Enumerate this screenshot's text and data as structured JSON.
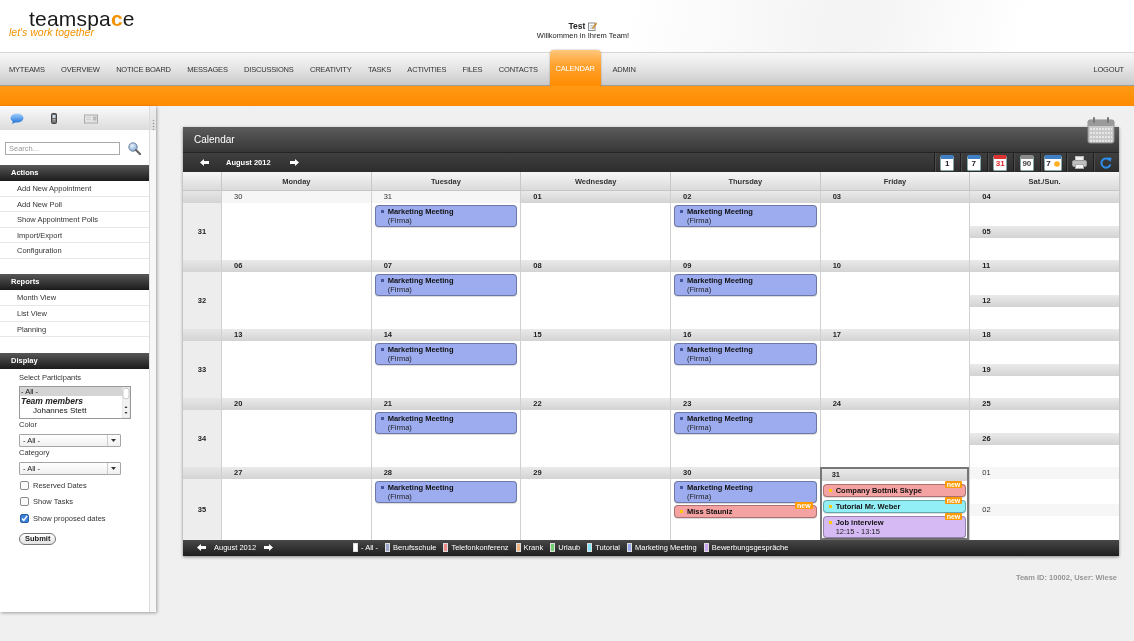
{
  "header": {
    "logo": {
      "wordmark": "teamspace",
      "tagline": "let's work together"
    },
    "user": {
      "name": "Test",
      "greeting": "Willkommen in Ihrem Team!"
    }
  },
  "nav": {
    "tabs": [
      {
        "label": "MYTEAMS",
        "selected": false
      },
      {
        "label": "OVERVIEW",
        "selected": false
      },
      {
        "label": "NOTICE BOARD",
        "selected": false
      },
      {
        "label": "MESSAGES",
        "selected": false
      },
      {
        "label": "DISCUSSIONS",
        "selected": false
      },
      {
        "label": "CREATIVITY",
        "selected": false
      },
      {
        "label": "TASKS",
        "selected": false
      },
      {
        "label": "ACTIVITIES",
        "selected": false
      },
      {
        "label": "FILES",
        "selected": false
      },
      {
        "label": "CONTACTS",
        "selected": false
      },
      {
        "label": "CALENDAR",
        "selected": true
      },
      {
        "label": "ADMIN",
        "selected": false
      }
    ],
    "logout": "LOGOUT"
  },
  "sidebar": {
    "search": {
      "placeholder": "Search..."
    },
    "sections": [
      {
        "title": "Actions",
        "items": [
          "Add New Appointment",
          "Add New Poll",
          "Show Appointment Polls",
          "Import/Export",
          "Configuration"
        ]
      },
      {
        "title": "Reports",
        "items": [
          "Month View",
          "List View",
          "Planning"
        ]
      }
    ],
    "display": {
      "title": "Display",
      "participants": {
        "label": "Select Participants",
        "options": [
          {
            "kind": "option",
            "label": "- All -",
            "selected": true
          },
          {
            "kind": "group",
            "label": "Team members",
            "children": [
              {
                "label": "Johannes Stett",
                "selected": false
              }
            ]
          }
        ]
      },
      "filters": [
        {
          "label": "Color",
          "value": "- All -"
        },
        {
          "label": "Category",
          "value": "- All -"
        }
      ],
      "checkboxes": [
        {
          "label": "Reserved Dates",
          "checked": false
        },
        {
          "label": "Show Tasks",
          "checked": false
        },
        {
          "label": "Show proposed dates",
          "checked": true
        }
      ],
      "submit": "Submit"
    }
  },
  "calendar": {
    "title": "Calendar",
    "month": "August 2012",
    "views": [
      {
        "kind": "day",
        "label": "1"
      },
      {
        "kind": "week",
        "label": "7"
      },
      {
        "kind": "month",
        "label": "31"
      },
      {
        "kind": "quarter",
        "label": "90"
      },
      {
        "kind": "year",
        "label": "7"
      },
      {
        "kind": "print"
      },
      {
        "kind": "refresh"
      }
    ],
    "weekday_headers": [
      "Monday",
      "Tuesday",
      "Wednesday",
      "Thursday",
      "Friday",
      "Sat./Sun."
    ],
    "weeks": [
      {
        "number": "31",
        "days": [
          {
            "date": "30",
            "other_month": true,
            "today": false
          },
          {
            "date": "31",
            "other_month": true,
            "today": false,
            "events": [
              {
                "title": "Marketing Meeting",
                "detail": "(Firma)",
                "color": "#9cacef",
                "new": false
              }
            ]
          },
          {
            "date": "01",
            "other_month": false,
            "today": false
          },
          {
            "date": "02",
            "other_month": false,
            "today": false,
            "events": [
              {
                "title": "Marketing Meeting",
                "detail": "(Firma)",
                "color": "#9cacef",
                "new": false
              }
            ]
          },
          {
            "date": "03",
            "other_month": false,
            "today": false
          }
        ],
        "weekend": [
          {
            "date": "04",
            "other_month": false
          },
          {
            "date": "05",
            "other_month": false
          }
        ]
      },
      {
        "number": "32",
        "days": [
          {
            "date": "06",
            "other_month": false,
            "today": false
          },
          {
            "date": "07",
            "other_month": false,
            "today": false,
            "events": [
              {
                "title": "Marketing Meeting",
                "detail": "(Firma)",
                "color": "#9cacef",
                "new": false
              }
            ]
          },
          {
            "date": "08",
            "other_month": false,
            "today": false
          },
          {
            "date": "09",
            "other_month": false,
            "today": false,
            "events": [
              {
                "title": "Marketing Meeting",
                "detail": "(Firma)",
                "color": "#9cacef",
                "new": false
              }
            ]
          },
          {
            "date": "10",
            "other_month": false,
            "today": false
          }
        ],
        "weekend": [
          {
            "date": "11",
            "other_month": false
          },
          {
            "date": "12",
            "other_month": false
          }
        ]
      },
      {
        "number": "33",
        "days": [
          {
            "date": "13",
            "other_month": false,
            "today": false
          },
          {
            "date": "14",
            "other_month": false,
            "today": false,
            "events": [
              {
                "title": "Marketing Meeting",
                "detail": "(Firma)",
                "color": "#9cacef",
                "new": false
              }
            ]
          },
          {
            "date": "15",
            "other_month": false,
            "today": false
          },
          {
            "date": "16",
            "other_month": false,
            "today": false,
            "events": [
              {
                "title": "Marketing Meeting",
                "detail": "(Firma)",
                "color": "#9cacef",
                "new": false
              }
            ]
          },
          {
            "date": "17",
            "other_month": false,
            "today": false
          }
        ],
        "weekend": [
          {
            "date": "18",
            "other_month": false
          },
          {
            "date": "19",
            "other_month": false
          }
        ]
      },
      {
        "number": "34",
        "days": [
          {
            "date": "20",
            "other_month": false,
            "today": false
          },
          {
            "date": "21",
            "other_month": false,
            "today": false,
            "events": [
              {
                "title": "Marketing Meeting",
                "detail": "(Firma)",
                "color": "#9cacef",
                "new": false
              }
            ]
          },
          {
            "date": "22",
            "other_month": false,
            "today": false
          },
          {
            "date": "23",
            "other_month": false,
            "today": false,
            "events": [
              {
                "title": "Marketing Meeting",
                "detail": "(Firma)",
                "color": "#9cacef",
                "new": false
              }
            ]
          },
          {
            "date": "24",
            "other_month": false,
            "today": false
          }
        ],
        "weekend": [
          {
            "date": "25",
            "other_month": false
          },
          {
            "date": "26",
            "other_month": false
          }
        ]
      },
      {
        "number": "35",
        "days": [
          {
            "date": "27",
            "other_month": false,
            "today": false
          },
          {
            "date": "28",
            "other_month": false,
            "today": false,
            "events": [
              {
                "title": "Marketing Meeting",
                "detail": "(Firma)",
                "color": "#9cacef",
                "new": false
              }
            ]
          },
          {
            "date": "29",
            "other_month": false,
            "today": false
          },
          {
            "date": "30",
            "other_month": false,
            "today": false,
            "events": [
              {
                "title": "Marketing Meeting",
                "detail": "(Firma)",
                "color": "#9cacef",
                "new": false
              },
              {
                "title": "Miss Stauniz",
                "color": "#f5a2a2",
                "new": true,
                "badge": "new"
              }
            ]
          },
          {
            "date": "31",
            "other_month": false,
            "today": true,
            "events": [
              {
                "title": "Company Bottnik Skype",
                "color": "#f5a2a2",
                "new": true,
                "badge": "new"
              },
              {
                "title": "Tutorial Mr. Weber",
                "color": "#92eff6",
                "new": true,
                "badge": "new"
              },
              {
                "title": "Job interview",
                "detail": "12:15 - 13:15",
                "color": "#d6baf4",
                "new": true,
                "badge": "new"
              }
            ]
          }
        ],
        "weekend": [
          {
            "date": "01",
            "other_month": true
          },
          {
            "date": "02",
            "other_month": true
          }
        ]
      }
    ],
    "legend": {
      "month": "August 2012",
      "categories": [
        {
          "label": "- All -",
          "color": "#ffffff"
        },
        {
          "label": "Berufsschule",
          "color": "#9aa4cc"
        },
        {
          "label": "Telefonkonferenz",
          "color": "#f08c8c"
        },
        {
          "label": "Krank",
          "color": "#f0b482"
        },
        {
          "label": "Urlaub",
          "color": "#72d072"
        },
        {
          "label": "Tutorial",
          "color": "#80e6f8"
        },
        {
          "label": "Marketing Meeting",
          "color": "#98a8ee"
        },
        {
          "label": "Bewerbungsgespräche",
          "color": "#c8a6f2"
        }
      ]
    }
  },
  "footer": "Team ID: 10002, User: Wiese"
}
